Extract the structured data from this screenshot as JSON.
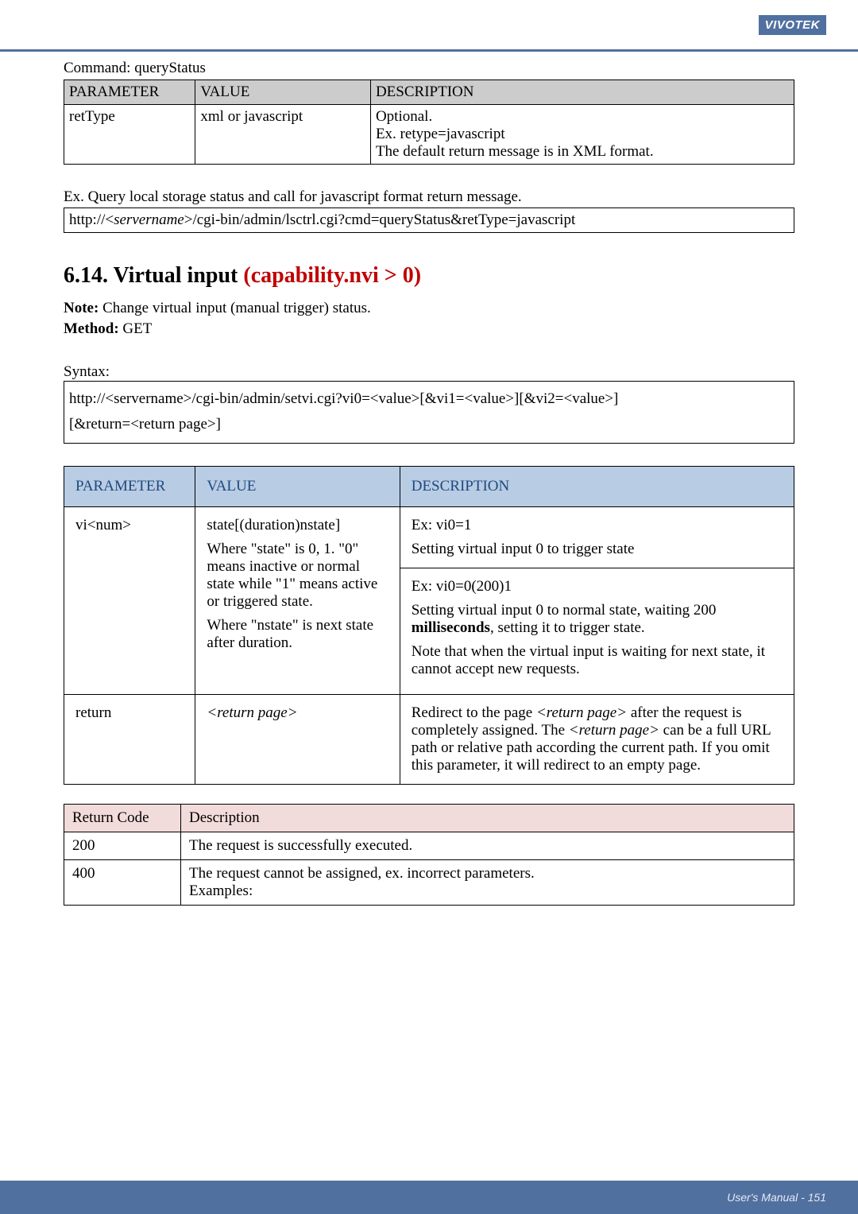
{
  "brand": "VIVOTEK",
  "command_label": "Command: queryStatus",
  "table1": {
    "headers": [
      "PARAMETER",
      "VALUE",
      "DESCRIPTION"
    ],
    "row": {
      "param": "retType",
      "value": "xml or javascript",
      "desc_l1": "Optional.",
      "desc_l2": "Ex. retype=javascript",
      "desc_l3": "The default return message is in XML format."
    }
  },
  "example_intro": "Ex. Query local storage status and call for javascript format return message.",
  "example_url_prefix": "http://<",
  "example_url_server": "servername",
  "example_url_suffix": ">/cgi-bin/admin/lsctrl.cgi?cmd=queryStatus&retType=javascript",
  "section_num": "6.14. Virtual input ",
  "section_cond": "(capability.nvi > 0)",
  "note_bold": "Note:",
  "note_text": " Change virtual input (manual trigger) status.",
  "method_bold": "Method:",
  "method_text": " GET",
  "syntax_label": "Syntax:",
  "syntax_l1": "http://<servername>/cgi-bin/admin/setvi.cgi?vi0=<value>[&vi1=<value>][&vi2=<value>]",
  "syntax_l2": "[&return=<return page>]",
  "table2": {
    "headers": [
      "PARAMETER",
      "VALUE",
      "DESCRIPTION"
    ],
    "row1": {
      "param": "vi<num>",
      "value_p1": "state[(duration)nstate]",
      "value_p2": "Where \"state\" is 0, 1. \"0\" means inactive or normal state while \"1\" means active or triggered state.",
      "value_p3": "Where \"nstate\" is next state after duration.",
      "desc_top_l1": "Ex: vi0=1",
      "desc_top_l2": "Setting virtual input 0 to trigger state",
      "desc_bot_l1": "Ex: vi0=0(200)1",
      "desc_bot_l2a": "Setting virtual input 0 to normal state, waiting 200 ",
      "desc_bot_l2b": "milliseconds",
      "desc_bot_l2c": ", setting it to trigger state.",
      "desc_bot_l3": "Note that when the virtual input is waiting for next state, it cannot accept new requests."
    },
    "row2": {
      "param": "return",
      "value": "<return page>",
      "desc_a": "Redirect to the page ",
      "desc_rp": "<return page>",
      "desc_b": " after the request is completely assigned. The ",
      "desc_c": " can be a full URL path or relative path according the current path. If you omit this parameter, it will redirect to an empty page."
    }
  },
  "table3": {
    "headers": [
      "Return Code",
      "Description"
    ],
    "row1": {
      "code": "200",
      "desc": "The request is successfully executed."
    },
    "row2": {
      "code": "400",
      "desc_l1": "The request cannot be assigned, ex. incorrect parameters.",
      "desc_l2": "Examples:"
    }
  },
  "footer": "User's Manual - 151"
}
